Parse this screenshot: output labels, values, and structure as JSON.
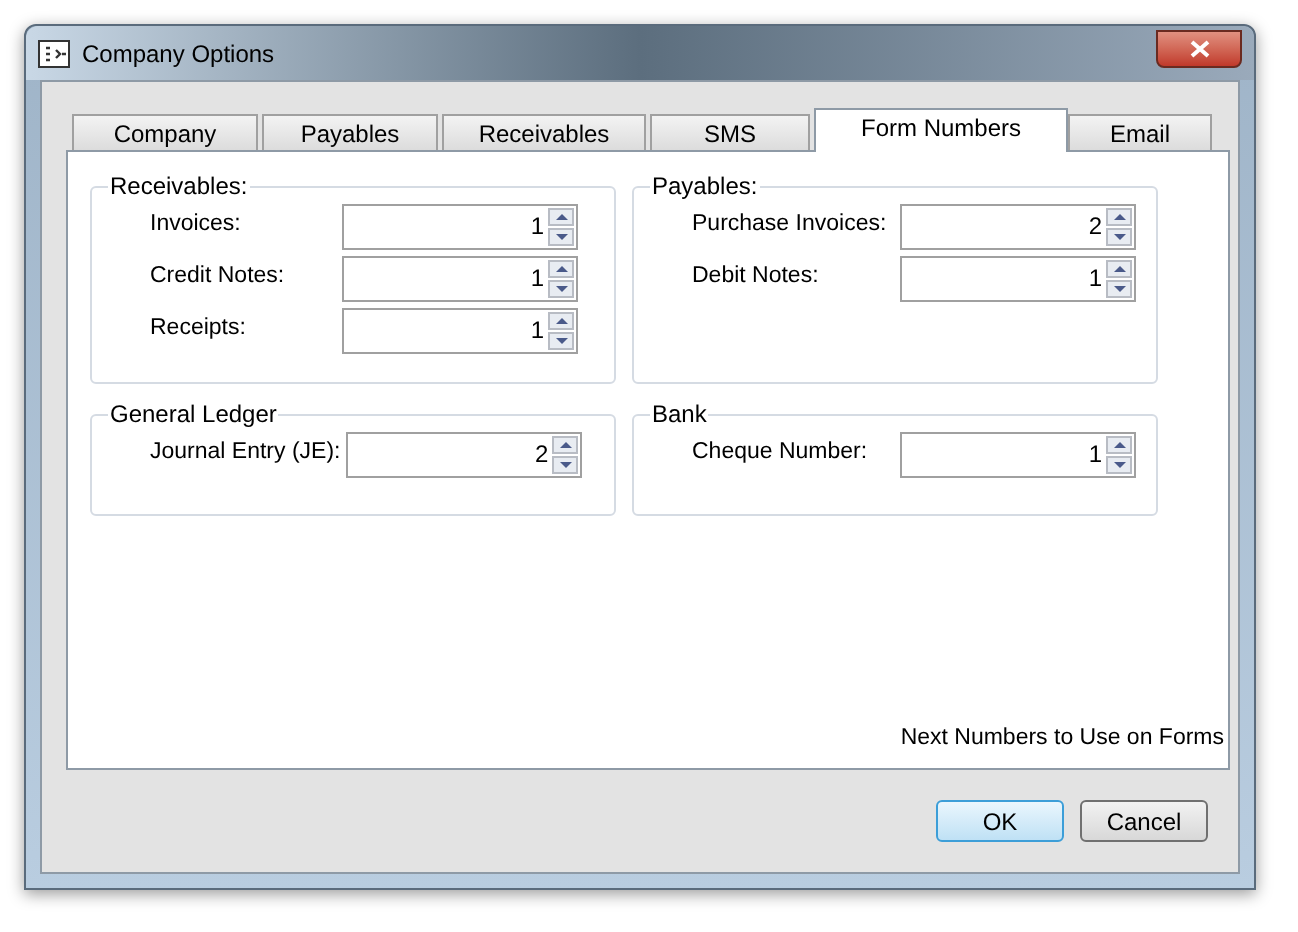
{
  "window": {
    "title": "Company Options"
  },
  "tabs": [
    {
      "label": "Company",
      "selected": false
    },
    {
      "label": "Payables",
      "selected": false
    },
    {
      "label": "Receivables",
      "selected": false
    },
    {
      "label": "SMS",
      "selected": false
    },
    {
      "label": "Form Numbers",
      "selected": true
    },
    {
      "label": "Email",
      "selected": false
    }
  ],
  "groups": [
    {
      "title": "Receivables:",
      "fields": [
        {
          "label": "Invoices:",
          "value": "1"
        },
        {
          "label": "Credit Notes:",
          "value": "1"
        },
        {
          "label": "Receipts:",
          "value": "1"
        }
      ]
    },
    {
      "title": "Payables:",
      "fields": [
        {
          "label": "Purchase Invoices:",
          "value": "2"
        },
        {
          "label": "Debit Notes:",
          "value": "1"
        }
      ]
    },
    {
      "title": "General Ledger",
      "fields": [
        {
          "label": "Journal Entry (JE):",
          "value": "2"
        }
      ]
    },
    {
      "title": "Bank",
      "fields": [
        {
          "label": "Cheque Number:",
          "value": "1"
        }
      ]
    }
  ],
  "note": "Next Numbers to Use on Forms",
  "buttons": [
    {
      "label": "OK",
      "default": true
    },
    {
      "label": "Cancel",
      "default": false
    }
  ]
}
